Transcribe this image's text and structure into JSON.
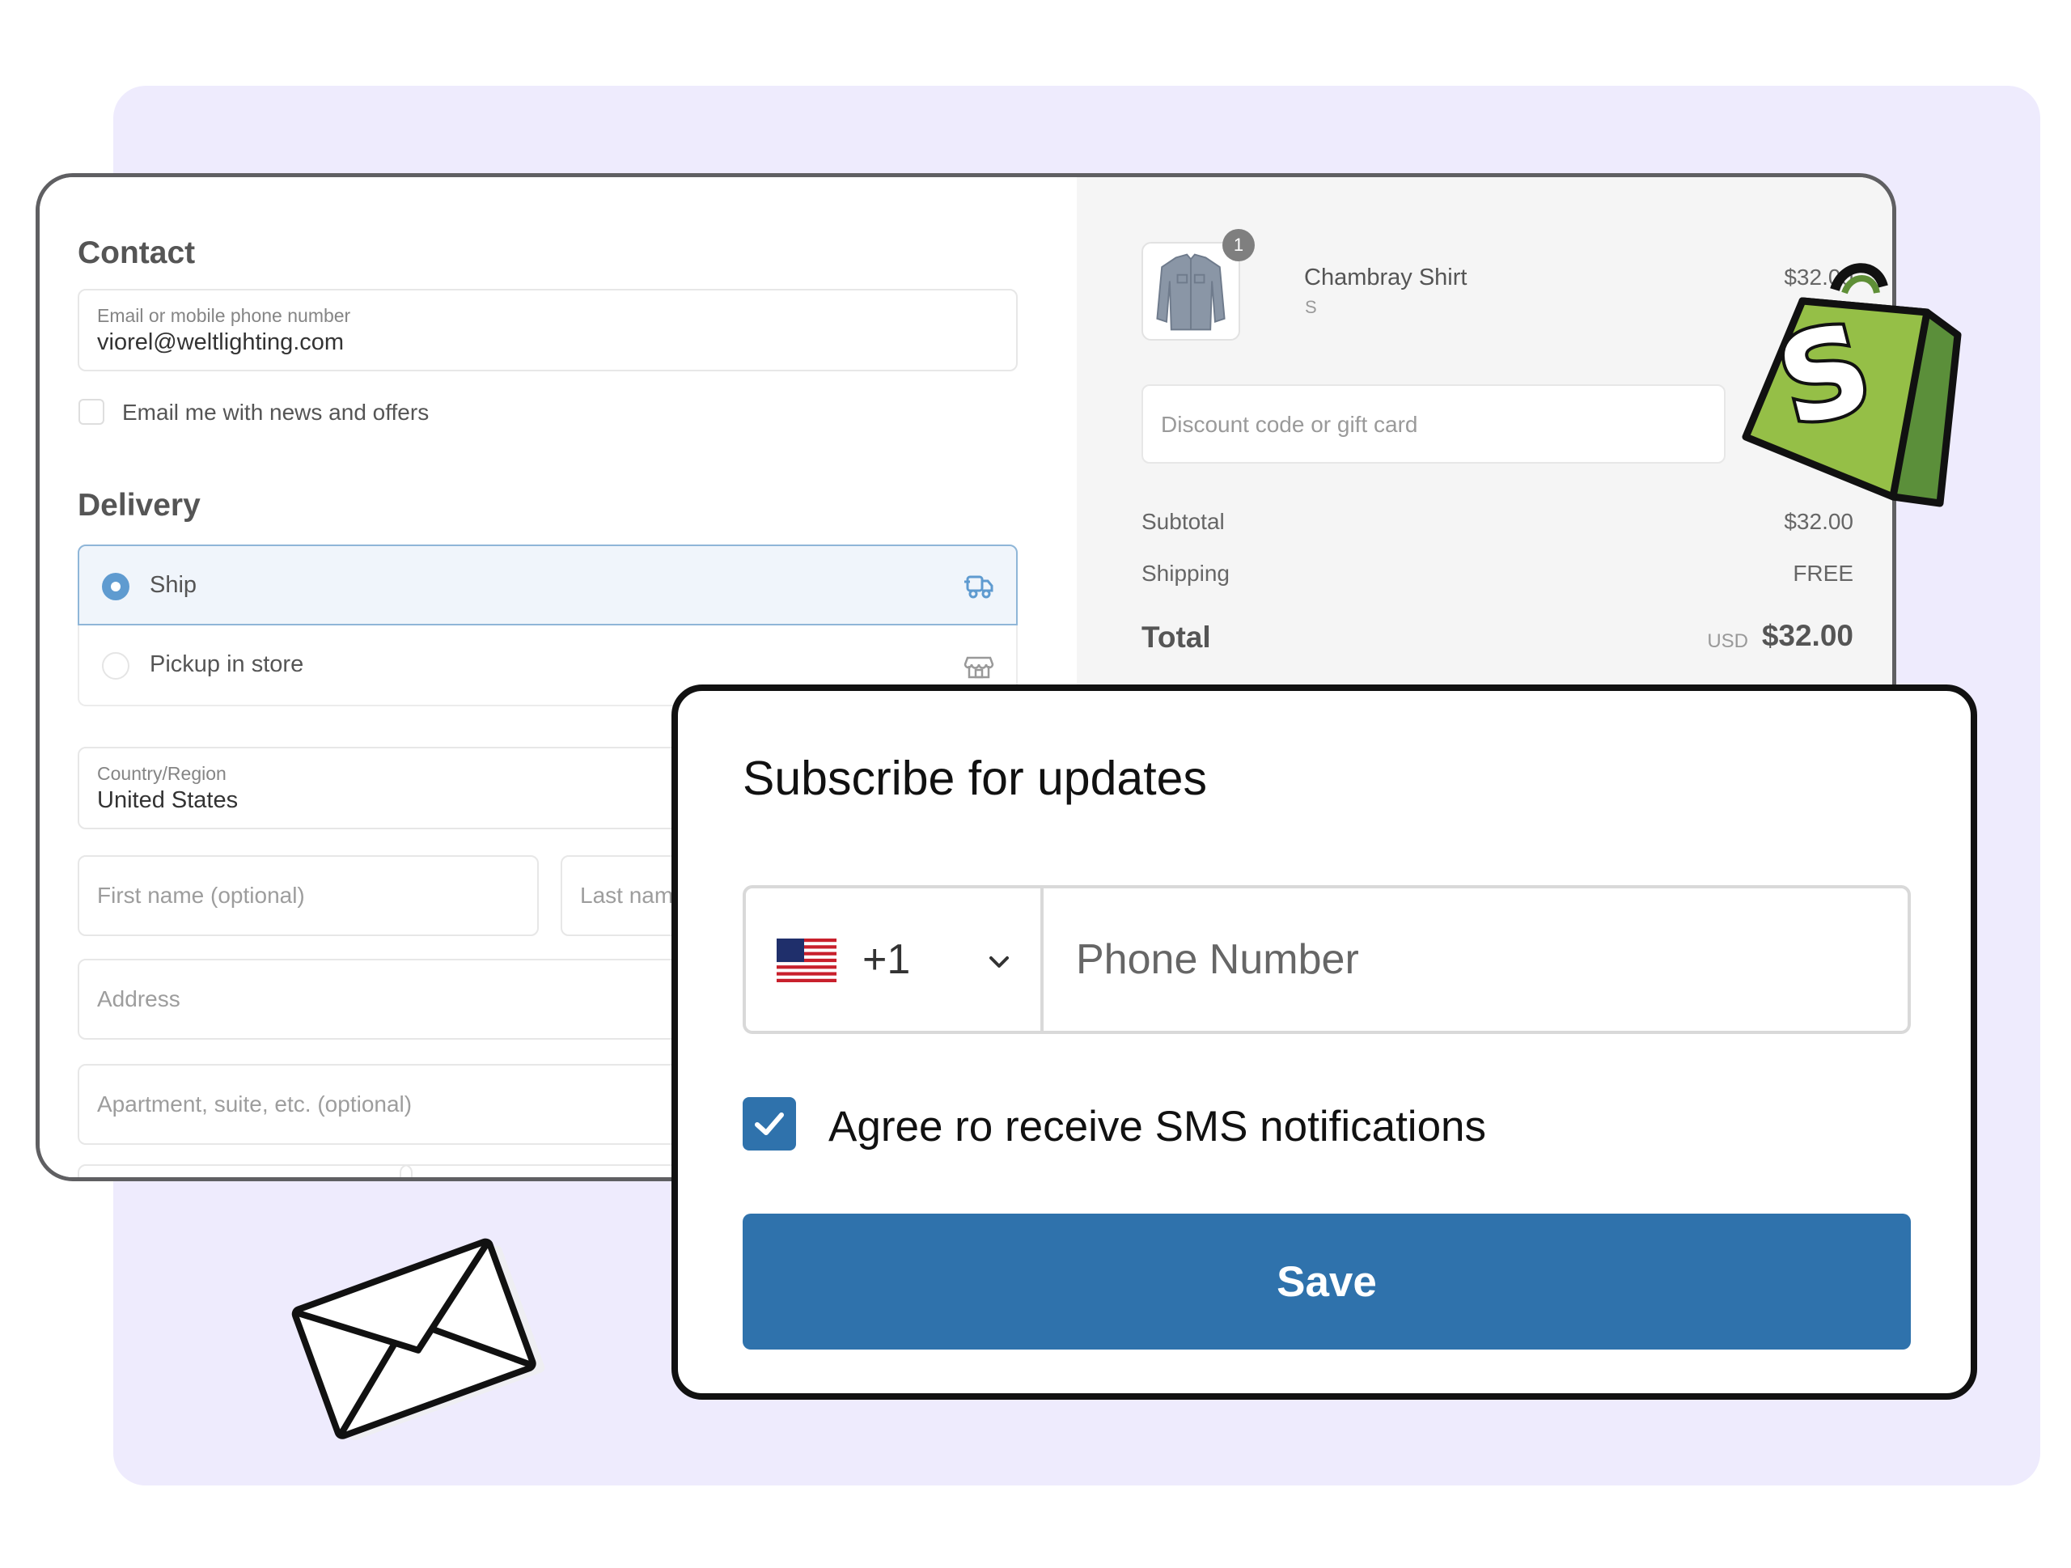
{
  "contact": {
    "heading": "Contact",
    "email_label": "Email or mobile phone number",
    "email_value": "viorel@weltlighting.com",
    "news_checkbox_label": "Email me with news and offers",
    "news_checked": false
  },
  "delivery": {
    "heading": "Delivery",
    "options": [
      {
        "label": "Ship",
        "selected": true,
        "icon": "truck-icon"
      },
      {
        "label": "Pickup in store",
        "selected": false,
        "icon": "store-icon"
      }
    ],
    "country_label": "Country/Region",
    "country_value": "United States",
    "first_name_placeholder": "First name (optional)",
    "last_name_placeholder": "Last name",
    "address_placeholder": "Address",
    "apartment_placeholder": "Apartment, suite, etc. (optional)"
  },
  "summary": {
    "product": {
      "name": "Chambray Shirt",
      "variant": "S",
      "price": "$32.00",
      "quantity": "1",
      "image_icon": "shirt-icon"
    },
    "discount_placeholder": "Discount code or gift card",
    "subtotal_label": "Subtotal",
    "subtotal_value": "$32.00",
    "shipping_label": "Shipping",
    "shipping_value": "FREE",
    "total_label": "Total",
    "total_currency": "USD",
    "total_value": "$32.00"
  },
  "subscribe": {
    "title": "Subscribe for updates",
    "country_code": "+1",
    "flag_icon": "us-flag-icon",
    "phone_placeholder": "Phone Number",
    "sms_label": "Agree ro receive SMS notifications",
    "sms_checked": true,
    "save_label": "Save"
  },
  "decor": {
    "logo_icon": "shopify-bag-icon",
    "envelope_icon": "envelope-icon",
    "logo_letter": "S"
  },
  "colors": {
    "background_panel": "#eeebfd",
    "primary": "#2f72ac",
    "shopify_green": "#95bf47",
    "selected_option_bg": "#f0f5fb"
  }
}
